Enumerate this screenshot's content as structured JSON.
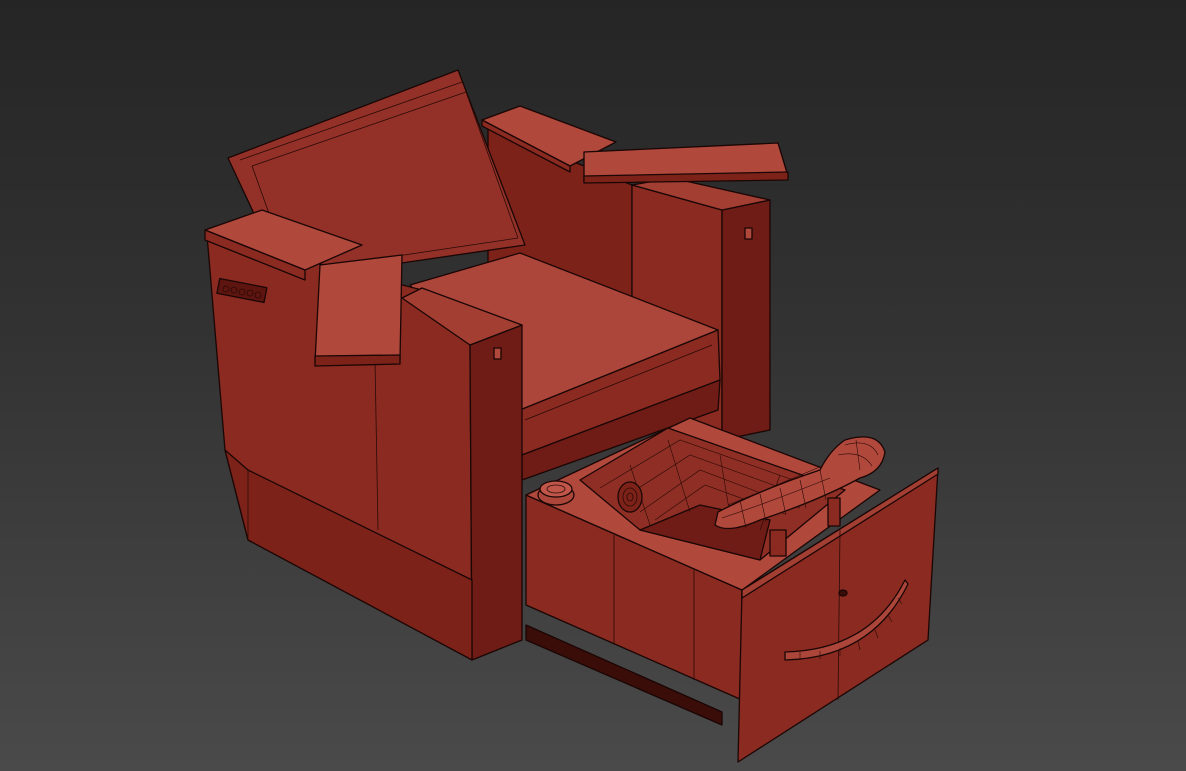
{
  "viewport": {
    "background_top": "#252525",
    "background_bottom": "#4a4a4a"
  },
  "model": {
    "object": "pedicure-spa-chair",
    "render_mode": "shaded-with-edged-faces",
    "colors": {
      "top_face": "#b0483c",
      "front_face": "#8a2a20",
      "dark_face": "#6e1c15",
      "edge_line": "#1a0604"
    }
  }
}
